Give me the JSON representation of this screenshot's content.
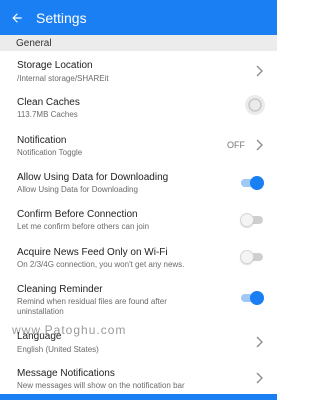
{
  "appbar": {
    "title": "Settings",
    "back_icon": "arrow-back-icon"
  },
  "section": {
    "title": "General"
  },
  "items": {
    "storage": {
      "title": "Storage Location",
      "subtitle": "/Internal storage/SHAREit"
    },
    "caches": {
      "title": "Clean Caches",
      "subtitle": "113.7MB Caches"
    },
    "notification": {
      "title": "Notification",
      "subtitle": "Notification Toggle",
      "value": "OFF"
    },
    "data_download": {
      "title": "Allow Using Data for Downloading",
      "subtitle": "Allow Using Data for Downloading",
      "enabled": true
    },
    "confirm": {
      "title": "Confirm Before Connection",
      "subtitle": "Let me confirm before others can join",
      "enabled": false
    },
    "news_feed": {
      "title": "Acquire News Feed Only on Wi-Fi",
      "subtitle": "On 2/3/4G connection, you won't get any news.",
      "enabled": false
    },
    "cleaning": {
      "title": "Cleaning Reminder",
      "subtitle1": "Remind when residual files are found after",
      "subtitle2": "uninstallation",
      "enabled": true
    },
    "language": {
      "title": "Language",
      "subtitle": "English (United States)"
    },
    "messages": {
      "title": "Message Notifications",
      "subtitle": "New messages will show on the notification bar"
    }
  },
  "watermark": {
    "text": "www.Patoghu.com"
  },
  "colors": {
    "accent": "#1a7ff3",
    "section_bg": "#ececec",
    "toggle_track_on": "#9fc8f6"
  }
}
